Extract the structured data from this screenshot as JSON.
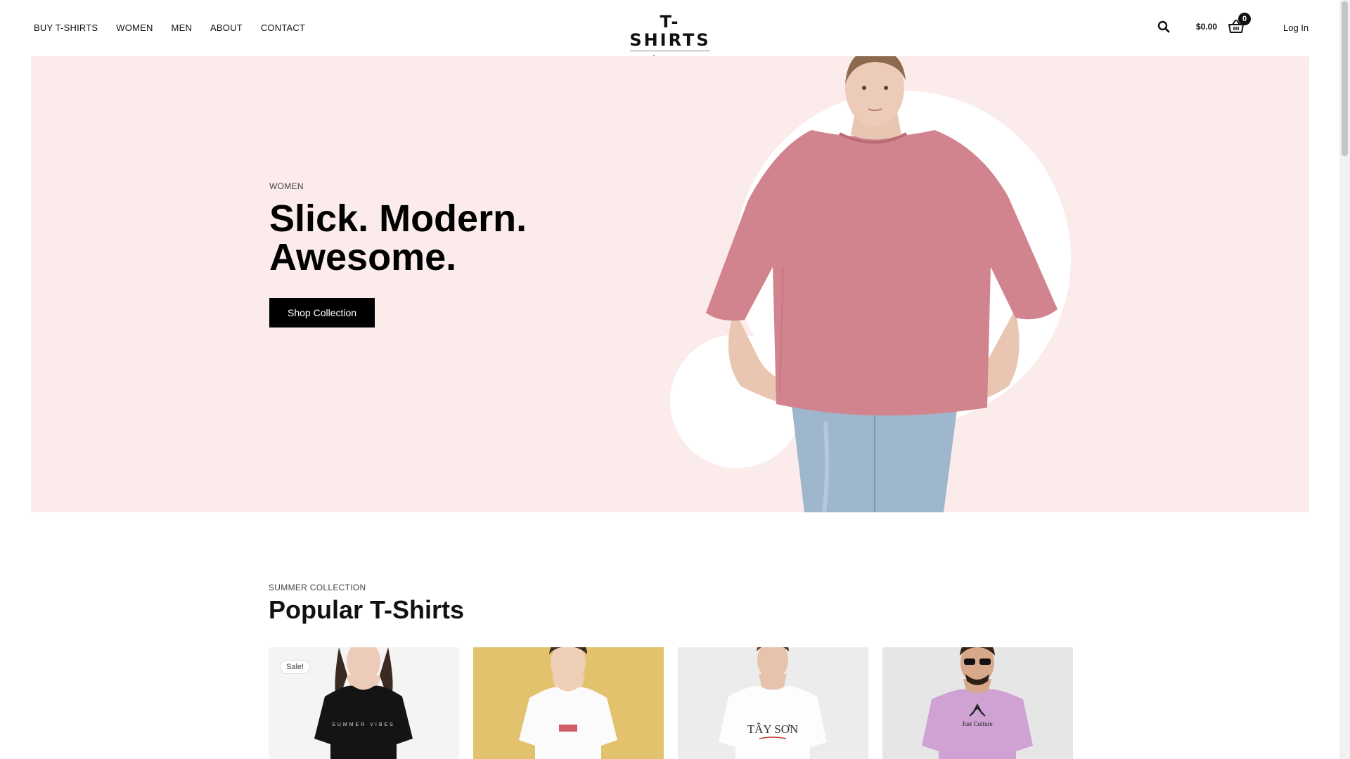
{
  "nav": {
    "items": [
      {
        "label": "BUY T-SHIRTS"
      },
      {
        "label": "WOMEN"
      },
      {
        "label": "MEN"
      },
      {
        "label": "ABOUT"
      },
      {
        "label": "CONTACT"
      }
    ]
  },
  "logo": {
    "main": "T-SHIRTS",
    "sub": "store"
  },
  "header": {
    "search_icon": "search-icon",
    "cart_total": "$0.00",
    "cart_count": "0",
    "cart_icon": "basket-icon",
    "login_label": "Log In"
  },
  "hero": {
    "eyebrow": "WOMEN",
    "title_line1": "Slick. Modern.",
    "title_line2": "Awesome.",
    "button_label": "Shop Collection",
    "background": "#fbeceb"
  },
  "collection": {
    "eyebrow": "SUMMER COLLECTION",
    "title": "Popular T-Shirts",
    "products": [
      {
        "badge": "Sale!",
        "shirt_color": "#141414",
        "bg": "#f4f4f4"
      },
      {
        "badge": "",
        "shirt_color": "#fbfbfb",
        "bg": "#e2c26d"
      },
      {
        "badge": "",
        "shirt_color": "#fdfdfd",
        "bg": "#ececec"
      },
      {
        "badge": "",
        "shirt_color": "#cfa2d3",
        "bg": "#e6e6e6"
      }
    ]
  }
}
